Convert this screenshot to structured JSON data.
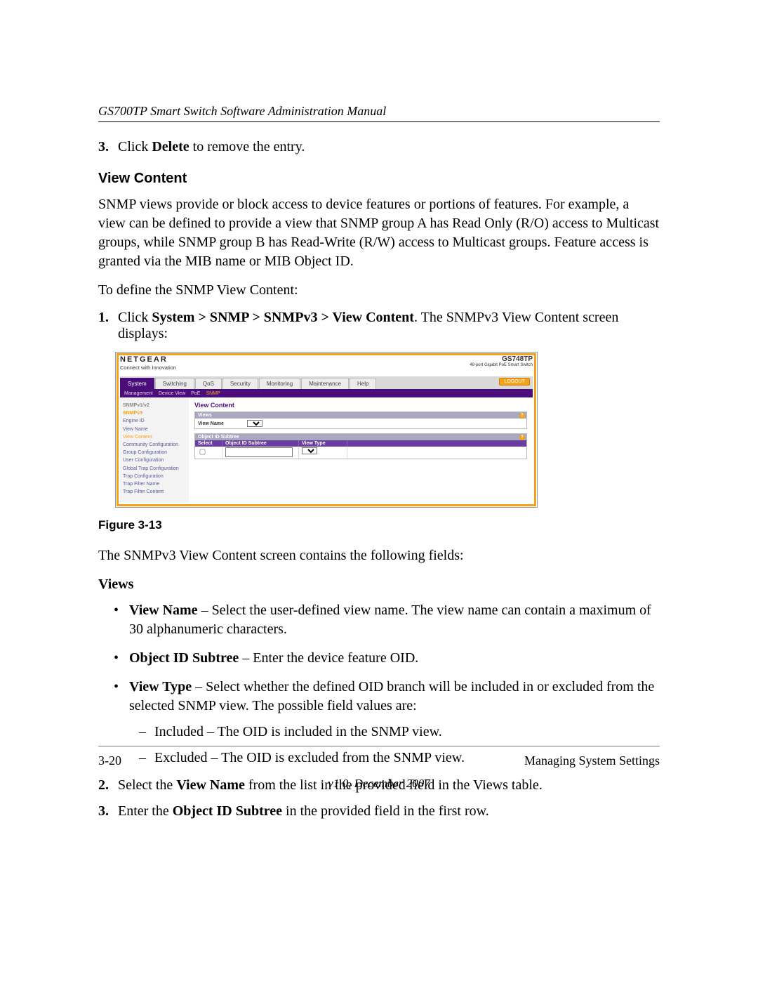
{
  "header": {
    "running": "GS700TP Smart Switch Software Administration Manual"
  },
  "s3": {
    "num": "3.",
    "text_a": "Click ",
    "bold": "Delete",
    "text_b": " to remove the entry."
  },
  "view_content_h": "View Content",
  "intro": "SNMP views provide or block access to device features or portions of features. For example, a view can be defined to provide a view that SNMP group A has Read Only (R/O) access to Multicast groups, while SNMP group B has Read-Write (R/W) access to Multicast groups. Feature access is granted via the MIB name or MIB Object ID.",
  "to_define": "To define the SNMP View Content:",
  "s1": {
    "num": "1.",
    "a": "Click ",
    "b": "System > SNMP > SNMPv3 > View Content",
    "c": ". The SNMPv3 View Content screen displays:"
  },
  "fig_label": "Figure 3-13",
  "after_fig": "The SNMPv3 View Content screen contains the following fields:",
  "views_h": "Views",
  "b1": {
    "k": "View Name",
    "t": " – Select the user-defined view name. The view name can contain a maximum of 30 alphanumeric characters."
  },
  "b2": {
    "k": "Object ID Subtree",
    "t": " – Enter the device feature OID."
  },
  "b3": {
    "k": "View Type",
    "t": " – Select whether the defined OID branch will be included in or excluded from the selected SNMP view. The possible field values are:"
  },
  "d1": "Included – The OID is included in the SNMP view.",
  "d2": "Excluded – The OID is excluded from the SNMP view.",
  "s2": {
    "num": "2.",
    "a": "Select the ",
    "b": "View Name",
    "c": " from the list in the provided field in the Views table."
  },
  "s3b": {
    "num": "3.",
    "a": "Enter the ",
    "b": "Object ID Subtree",
    "c": " in the provided field in the first row."
  },
  "footer": {
    "page": "3-20",
    "section": "Managing System Settings",
    "version": "v1.0, December 2007"
  },
  "shot": {
    "logo": "NETGEAR",
    "tag": "Connect with Innovation",
    "model": "GS748TP",
    "model_d": "48-port Gigabit PoE Smart Switch",
    "tabs": [
      "System",
      "Switching",
      "QoS",
      "Security",
      "Monitoring",
      "Maintenance",
      "Help"
    ],
    "logout": "LOGOUT",
    "sub": [
      "Management",
      "Device View",
      "PoE",
      "SNMP"
    ],
    "side_grp": "SNMPv1/v2",
    "side_grp2": "SNMPv3",
    "side": [
      "Engine ID",
      "View Name",
      "View Content",
      "Community Configuration",
      "Group Configuration",
      "User Configuration",
      "Global Trap Configuration",
      "Trap Configuration",
      "Trap Filter Name",
      "Trap Filter Content"
    ],
    "title": "View Content",
    "panel1": "Views",
    "panel1_lbl": "View Name",
    "panel2": "Object ID Subtree",
    "th": [
      "Select",
      "Object ID Subtree",
      "View Type"
    ]
  }
}
